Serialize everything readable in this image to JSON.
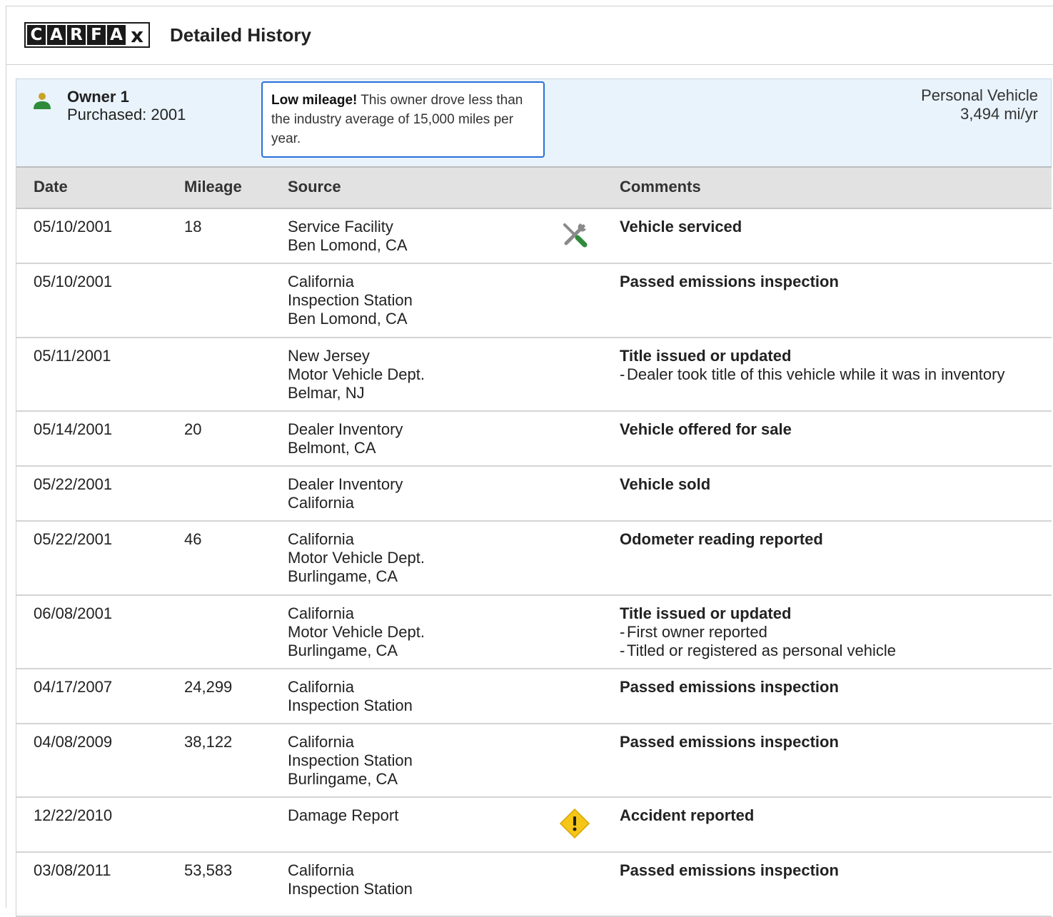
{
  "header": {
    "logo_letters": [
      "C",
      "A",
      "R",
      "F",
      "A",
      "x"
    ],
    "title": "Detailed History"
  },
  "owner": {
    "name": "Owner 1",
    "purchased": "Purchased: 2001",
    "callout_bold": "Low mileage!",
    "callout_text": " This owner drove less than the industry average of 15,000 miles per year.",
    "vehicle_type": "Personal Vehicle",
    "miles_per_year": "3,494 mi/yr"
  },
  "table": {
    "columns": [
      "Date",
      "Mileage",
      "Source",
      "Comments"
    ],
    "rows": [
      {
        "date": "05/10/2001",
        "mileage": "18",
        "source": [
          "Service Facility",
          "Ben Lomond, CA"
        ],
        "icon": "wrench-screwdriver-icon",
        "comment_title": "Vehicle serviced",
        "comment_items": []
      },
      {
        "date": "05/10/2001",
        "mileage": "",
        "source": [
          "California",
          "Inspection Station",
          "Ben Lomond, CA"
        ],
        "icon": "",
        "comment_title": "Passed emissions inspection",
        "comment_items": []
      },
      {
        "date": "05/11/2001",
        "mileage": "",
        "source": [
          "New Jersey",
          "Motor Vehicle Dept.",
          "Belmar, NJ"
        ],
        "icon": "",
        "comment_title": "Title issued or updated",
        "comment_items": [
          "Dealer took title of this vehicle while it was in inventory"
        ]
      },
      {
        "date": "05/14/2001",
        "mileage": "20",
        "source": [
          "Dealer Inventory",
          "Belmont, CA"
        ],
        "icon": "",
        "comment_title": "Vehicle offered for sale",
        "comment_items": []
      },
      {
        "date": "05/22/2001",
        "mileage": "",
        "source": [
          "Dealer Inventory",
          "California"
        ],
        "icon": "",
        "comment_title": "Vehicle sold",
        "comment_items": []
      },
      {
        "date": "05/22/2001",
        "mileage": "46",
        "source": [
          "California",
          "Motor Vehicle Dept.",
          "Burlingame, CA"
        ],
        "icon": "",
        "comment_title": "Odometer reading reported",
        "comment_items": []
      },
      {
        "date": "06/08/2001",
        "mileage": "",
        "source": [
          "California",
          "Motor Vehicle Dept.",
          "Burlingame, CA"
        ],
        "icon": "",
        "comment_title": "Title issued or updated",
        "comment_items": [
          "First owner reported",
          "Titled or registered as personal vehicle"
        ]
      },
      {
        "date": "04/17/2007",
        "mileage": "24,299",
        "source": [
          "California",
          "Inspection Station"
        ],
        "icon": "",
        "comment_title": "Passed emissions inspection",
        "comment_items": []
      },
      {
        "date": "04/08/2009",
        "mileage": "38,122",
        "source": [
          "California",
          "Inspection Station",
          "Burlingame, CA"
        ],
        "icon": "",
        "comment_title": "Passed emissions inspection",
        "comment_items": []
      },
      {
        "date": "12/22/2010",
        "mileage": "",
        "source": [
          "Damage Report"
        ],
        "icon": "warning-icon",
        "comment_title": "Accident reported",
        "comment_items": []
      },
      {
        "date": "03/08/2011",
        "mileage": "53,583",
        "source": [
          "California",
          "Inspection Station"
        ],
        "icon": "",
        "comment_title": "Passed emissions inspection",
        "comment_items": []
      }
    ]
  },
  "colors": {
    "owner_panel_bg": "#e9f3fb",
    "callout_border": "#2a6fd8",
    "person_head": "#c9a227",
    "person_body": "#2e8b3a",
    "warning": "#f5c518",
    "tool_green": "#2e8b3a"
  }
}
